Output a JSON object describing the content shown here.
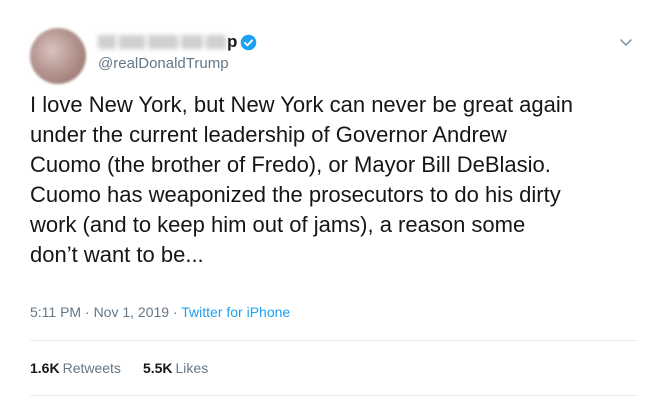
{
  "tweet": {
    "name_suffix": "p",
    "handle": "@realDonaldTrump",
    "text": "I love New York, but New York can never be great again\nunder the current leadership of Governor Andrew\nCuomo (the brother of Fredo), or Mayor Bill DeBlasio.\nCuomo has weaponized the prosecutors to do his dirty\nwork (and to keep him out of jams), a reason some\ndon’t want to be...",
    "time": "5:11 PM",
    "date": "Nov 1, 2019",
    "separator": " · ",
    "source": "Twitter for iPhone",
    "retweets_count": "1.6K",
    "retweets_label": "Retweets",
    "likes_count": "5.5K",
    "likes_label": "Likes"
  },
  "colors": {
    "accent": "#1da1f2",
    "muted": "#657786",
    "text": "#14171a",
    "divider": "#e6ecf0"
  },
  "icons": {
    "verified": "verified-badge-icon",
    "menu": "chevron-down-icon"
  }
}
